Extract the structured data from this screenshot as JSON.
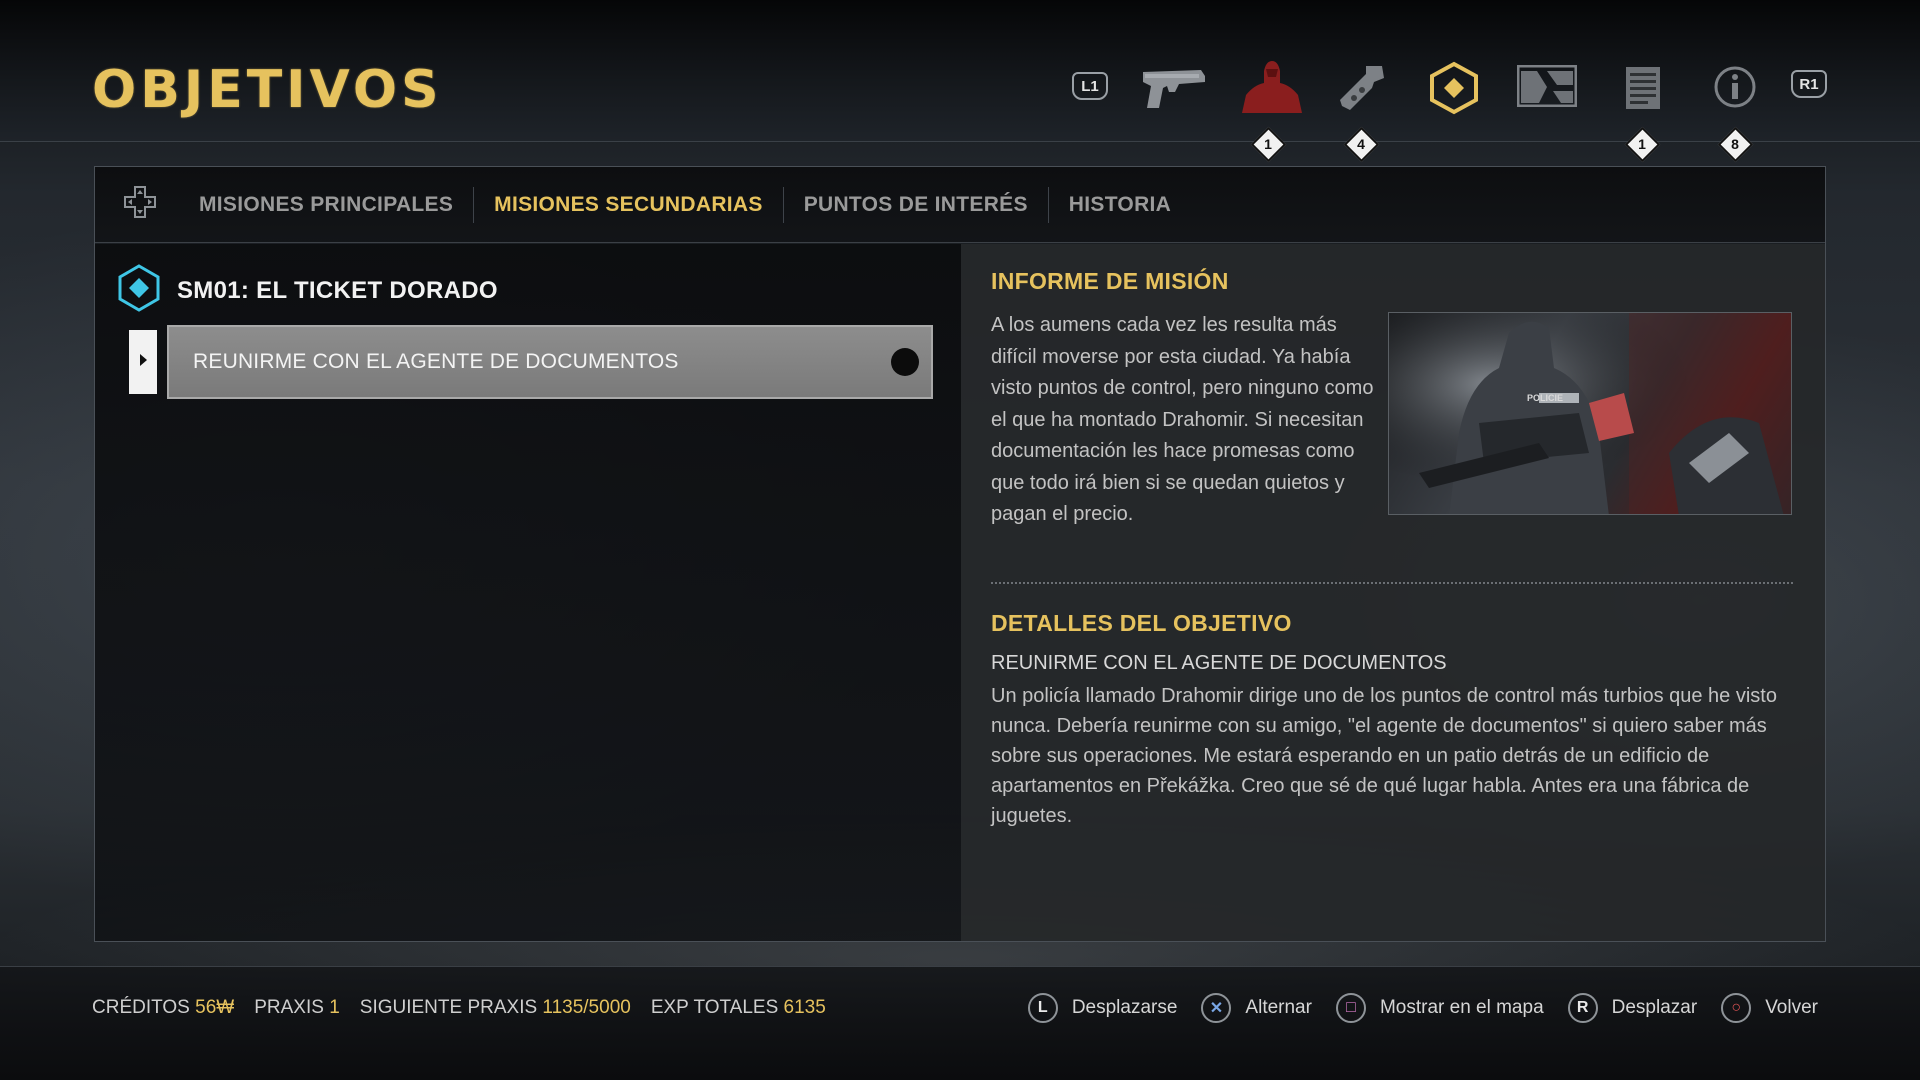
{
  "page": {
    "title": "OBJETIVOS"
  },
  "topnav": {
    "left_shoulder": "L1",
    "right_shoulder": "R1",
    "items": [
      {
        "icon": "pistol-icon",
        "badge": ""
      },
      {
        "icon": "augmentations-icon",
        "badge": "1"
      },
      {
        "icon": "crafting-icon",
        "badge": "4"
      },
      {
        "icon": "objectives-icon",
        "badge": ""
      },
      {
        "icon": "map-icon",
        "badge": ""
      },
      {
        "icon": "database-icon",
        "badge": "1"
      },
      {
        "icon": "info-icon",
        "badge": "8"
      }
    ],
    "accent_color": "#e6c25e"
  },
  "tabs": [
    {
      "label": "MISIONES PRINCIPALES",
      "active": false
    },
    {
      "label": "MISIONES SECUNDARIAS",
      "active": true
    },
    {
      "label": "PUNTOS DE INTERÉS",
      "active": false
    },
    {
      "label": "HISTORIA",
      "active": false
    }
  ],
  "mission": {
    "title": "SM01: EL TICKET DORADO",
    "objective": "REUNIRME CON EL AGENTE DE DOCUMENTOS",
    "icon_color": "#3fc6e6"
  },
  "informe": {
    "heading": "INFORME DE MISIÓN",
    "text": "A los aumens cada vez les resulta más difícil moverse por esta ciudad. Ya había visto puntos de control, pero ninguno como el que ha montado Drahomir. Si necesitan documentación les hace promesas como que todo irá bien si se quedan quietos y pagan el precio.",
    "image_label": "POLICIE"
  },
  "detalles": {
    "heading": "DETALLES DEL OBJETIVO",
    "subheading": "REUNIRME CON EL AGENTE DE DOCUMENTOS",
    "text": "Un policía llamado Drahomir dirige uno de los puntos de control más turbios que he visto nunca. Debería reunirme con su amigo, \"el agente de documentos\" si quiero saber más sobre sus operaciones. Me estará esperando en un patio detrás de un edificio de apartamentos en Překážka. Creo que sé de qué lugar habla. Antes era una fábrica de juguetes."
  },
  "footer": {
    "stats": [
      {
        "label": "CRÉDITOS",
        "value": "56₩"
      },
      {
        "label": "PRAXIS",
        "value": "1"
      },
      {
        "label": "SIGUIENTE PRAXIS",
        "value": "1135/5000"
      },
      {
        "label": "EXP TOTALES",
        "value": "6135"
      }
    ],
    "controls": [
      {
        "glyph": "L",
        "label": "Desplazarse"
      },
      {
        "glyph": "✕",
        "label": "Alternar"
      },
      {
        "glyph": "□",
        "label": "Mostrar en el mapa"
      },
      {
        "glyph": "R",
        "label": "Desplazar"
      },
      {
        "glyph": "○",
        "label": "Volver"
      }
    ]
  }
}
